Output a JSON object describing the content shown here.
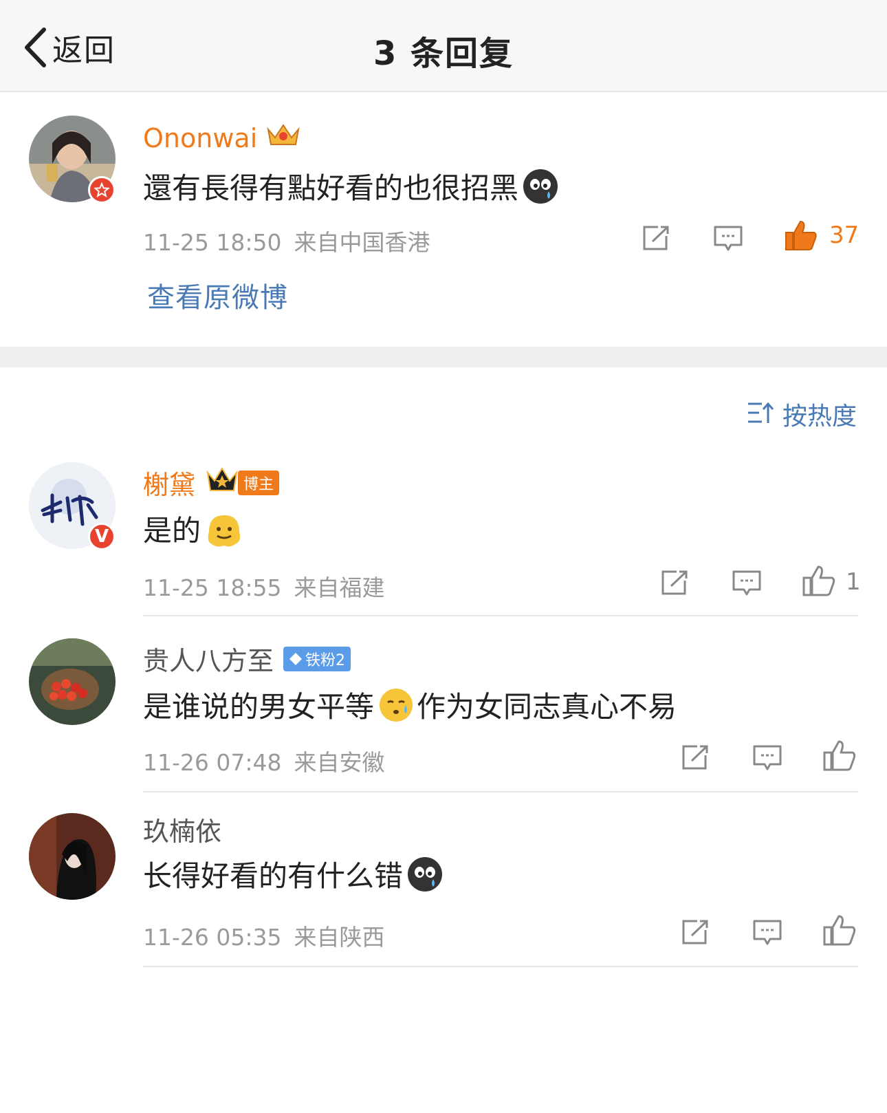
{
  "header": {
    "back_label": "返回",
    "title": "3 条回复"
  },
  "root": {
    "username": "Ononwai",
    "text": "還有長得有點好看的也很招黑",
    "date": "11-25 18:50",
    "location": "来自中国香港",
    "likes": "37",
    "view_original": "查看原微博"
  },
  "sort": {
    "label": "按热度"
  },
  "replies": [
    {
      "username": "榭黛",
      "tag": "博主",
      "text": "是的",
      "date": "11-25 18:55",
      "location": "来自福建",
      "likes": "1"
    },
    {
      "username": "贵人八方至",
      "tag": "铁粉2",
      "text_a": "是谁说的男女平等",
      "text_b": "作为女同志真心不易",
      "date": "11-26 07:48",
      "location": "来自安徽",
      "likes": ""
    },
    {
      "username": "玖楠依",
      "text": "长得好看的有什么错",
      "date": "11-26 05:35",
      "location": "来自陕西",
      "likes": ""
    }
  ],
  "colors": {
    "accent_orange": "#f07a19",
    "link_blue": "#4a7ab5",
    "meta_gray": "#9a9a9a"
  }
}
